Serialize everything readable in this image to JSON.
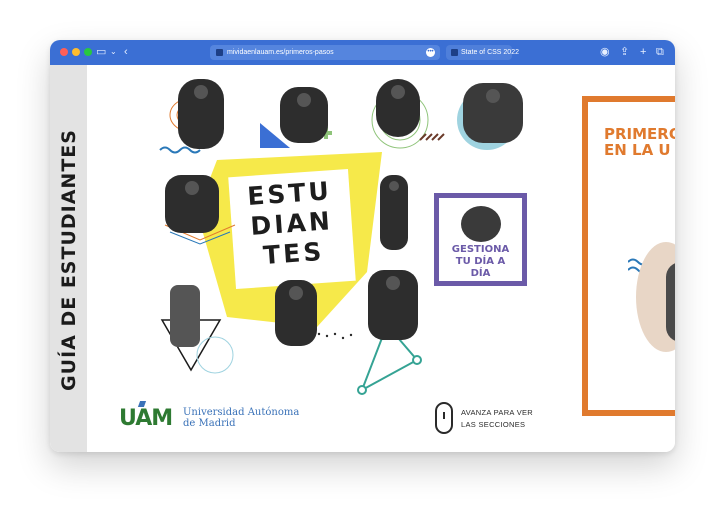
{
  "browser": {
    "address_url": "mividaenlauam.es/primeros-pasos",
    "second_tab_label": "State of CSS 2022"
  },
  "sidebar": {
    "title": "GUÍA DE ESTUDIANTES"
  },
  "hero": {
    "stamp_text": "ESTU\nDIAN\nTES"
  },
  "cards": {
    "gestiona": "GESTIONA\nTU DÍA A\nDÍA",
    "primeros": "PRIMERO\nEN LA U"
  },
  "footer": {
    "logo_text": "UAM",
    "university_line1": "Universidad Autónoma",
    "university_line2": "de Madrid",
    "scroll_hint_line1": "AVANZA PARA VER",
    "scroll_hint_line2": "LAS SECCIONES"
  },
  "colors": {
    "browser_chrome": "#3b6fd4",
    "yellow": "#f6e94a",
    "purple": "#6b5aa8",
    "orange": "#e07a2e",
    "uam_green": "#2e7a32",
    "uam_blue": "#3a72b8"
  }
}
